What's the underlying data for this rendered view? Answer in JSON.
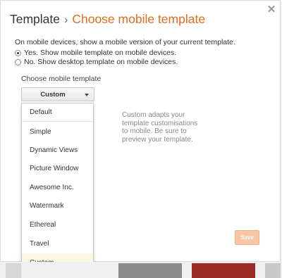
{
  "dialog": {
    "title": "Template",
    "separator": "›",
    "subtitle": "Choose mobile template",
    "close_icon": "close-icon"
  },
  "mobile": {
    "description": "On mobile devices, show a mobile version of your current template.",
    "options": [
      {
        "label": "Yes. Show mobile template on mobile devices.",
        "checked": true
      },
      {
        "label": "No. Show desktop template on mobile devices.",
        "checked": false
      }
    ],
    "choose_label": "Choose mobile template",
    "selected_value": "Custom",
    "templates": [
      "Default",
      "Simple",
      "Dynamic Views",
      "Picture Window",
      "Awesome Inc.",
      "Watermark",
      "Ethereal",
      "Travel",
      "Custom"
    ],
    "hint": "Custom adapts your template customisations to mobile. Be sure to preview your template."
  },
  "actions": {
    "save_label": "Save"
  },
  "colors": {
    "accent": "#e06c1f",
    "save_disabled": "#f7c6a5",
    "selected_item": "#fdf6e0"
  }
}
